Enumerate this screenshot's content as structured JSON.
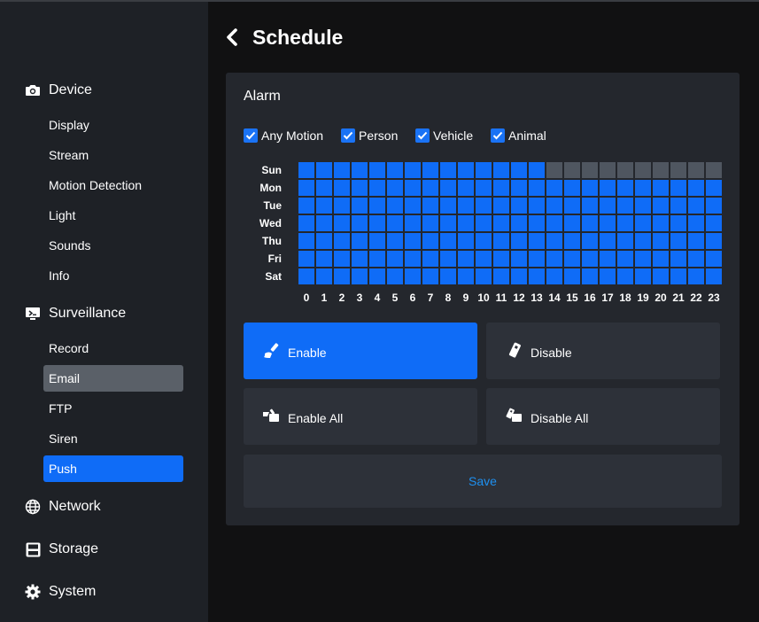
{
  "sidebar": {
    "sections": [
      {
        "label": "Device",
        "icon": "camera-icon",
        "items": [
          "Display",
          "Stream",
          "Motion Detection",
          "Light",
          "Sounds",
          "Info"
        ]
      },
      {
        "label": "Surveillance",
        "icon": "monitor-icon",
        "items": [
          "Record",
          "Email",
          "FTP",
          "Siren",
          "Push"
        ]
      },
      {
        "label": "Network",
        "icon": "globe-icon",
        "items": []
      },
      {
        "label": "Storage",
        "icon": "save-disk-icon",
        "items": []
      },
      {
        "label": "System",
        "icon": "gear-icon",
        "items": []
      }
    ],
    "highlighted_item": "Email",
    "active_item": "Push"
  },
  "header": {
    "title": "Schedule",
    "back_icon": "chevron-left-icon"
  },
  "panel": {
    "title": "Alarm",
    "checkboxes": [
      {
        "label": "Any Motion",
        "checked": true
      },
      {
        "label": "Person",
        "checked": true
      },
      {
        "label": "Vehicle",
        "checked": true
      },
      {
        "label": "Animal",
        "checked": true
      }
    ],
    "schedule": {
      "days": [
        "Sun",
        "Mon",
        "Tue",
        "Wed",
        "Thu",
        "Fri",
        "Sat"
      ],
      "hours": [
        "0",
        "1",
        "2",
        "3",
        "4",
        "5",
        "6",
        "7",
        "8",
        "9",
        "10",
        "11",
        "12",
        "13",
        "14",
        "15",
        "16",
        "17",
        "18",
        "19",
        "20",
        "21",
        "22",
        "23"
      ],
      "enabled": {
        "Sun": [
          0,
          1,
          2,
          3,
          4,
          5,
          6,
          7,
          8,
          9,
          10,
          11,
          12,
          13
        ],
        "Mon": [
          0,
          1,
          2,
          3,
          4,
          5,
          6,
          7,
          8,
          9,
          10,
          11,
          12,
          13,
          14,
          15,
          16,
          17,
          18,
          19,
          20,
          21,
          22,
          23
        ],
        "Tue": [
          0,
          1,
          2,
          3,
          4,
          5,
          6,
          7,
          8,
          9,
          10,
          11,
          12,
          13,
          14,
          15,
          16,
          17,
          18,
          19,
          20,
          21,
          22,
          23
        ],
        "Wed": [
          0,
          1,
          2,
          3,
          4,
          5,
          6,
          7,
          8,
          9,
          10,
          11,
          12,
          13,
          14,
          15,
          16,
          17,
          18,
          19,
          20,
          21,
          22,
          23
        ],
        "Thu": [
          0,
          1,
          2,
          3,
          4,
          5,
          6,
          7,
          8,
          9,
          10,
          11,
          12,
          13,
          14,
          15,
          16,
          17,
          18,
          19,
          20,
          21,
          22,
          23
        ],
        "Fri": [
          0,
          1,
          2,
          3,
          4,
          5,
          6,
          7,
          8,
          9,
          10,
          11,
          12,
          13,
          14,
          15,
          16,
          17,
          18,
          19,
          20,
          21,
          22,
          23
        ],
        "Sat": [
          0,
          1,
          2,
          3,
          4,
          5,
          6,
          7,
          8,
          9,
          10,
          11,
          12,
          13,
          14,
          15,
          16,
          17,
          18,
          19,
          20,
          21,
          22,
          23
        ]
      }
    },
    "buttons": {
      "enable": "Enable",
      "disable": "Disable",
      "enable_all": "Enable All",
      "disable_all": "Disable All",
      "save": "Save"
    }
  },
  "colors": {
    "accent": "#0f6cf7",
    "cell_off": "#4f5660",
    "sidebar_bg": "#1e2126",
    "panel_bg": "#24272d",
    "button_bg": "#2d3139",
    "save_text": "#1e90f0",
    "highlight_gray": "#5a6068"
  }
}
